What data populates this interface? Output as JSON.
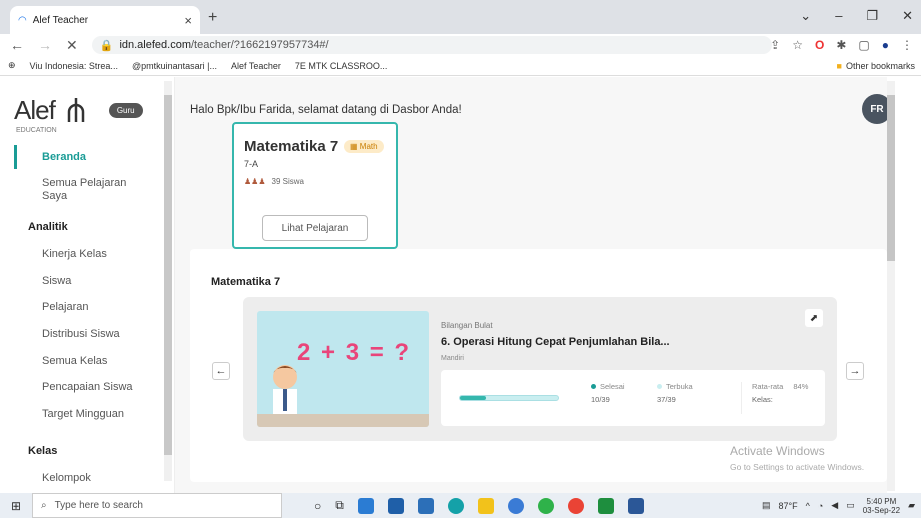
{
  "browser": {
    "tab_title": "Alef Teacher",
    "url_domain": "idn.alefed.com",
    "url_path": "/teacher/?1662197957734#/",
    "bookmarks": [
      "Viu Indonesia: Strea...",
      "@pmtkuinantasari |...",
      "Alef Teacher",
      "7E MTK CLASSROO..."
    ],
    "other_bookmarks": "Other bookmarks"
  },
  "sidebar": {
    "logo_text": "Alef",
    "logo_sub": "EDUCATION",
    "role_badge": "Guru",
    "items": [
      {
        "label": "Beranda"
      },
      {
        "label": "Semua Pelajaran Saya"
      }
    ],
    "analitik_header": "Analitik",
    "analitik_items": [
      "Kinerja Kelas",
      "Siswa",
      "Pelajaran",
      "Distribusi Siswa",
      "Semua Kelas",
      "Pencapaian Siswa",
      "Target Mingguan"
    ],
    "kelas_header": "Kelas",
    "kelas_items": [
      "Kelompok"
    ]
  },
  "main": {
    "greeting": "Halo Bpk/Ibu Farida, selamat datang di Dasbor Anda!",
    "avatar_initials": "FR",
    "course_card": {
      "title": "Matematika 7",
      "subject_badge": "Math",
      "class": "7-A",
      "students": "39 Siswa",
      "button": "Lihat Pelajaran"
    },
    "panel": {
      "title": "Matematika 7",
      "lesson": {
        "category": "Bilangan Bulat",
        "title": "6. Operasi Hitung Cepat Penjumlahan Bila...",
        "mode": "Mandiri",
        "thumbnail_equation": "2 + 3 = ?",
        "progress_fraction": 0.27,
        "completed_label": "Selesai",
        "completed_value": "10/39",
        "open_label": "Terbuka",
        "open_value": "37/39",
        "avg_label": "Rata-rata",
        "avg_value": "84%",
        "avg_sub": "Kelas:"
      }
    }
  },
  "watermark": {
    "title": "Activate Windows",
    "sub": "Go to Settings to activate Windows."
  },
  "taskbar": {
    "search_placeholder": "Type here to search",
    "weather": "87°F",
    "time": "5:40 PM",
    "date": "03-Sep-22"
  },
  "colors": {
    "accent": "#35b7ad",
    "accent_dark": "#1a9c96",
    "badge": "#fdebc8"
  }
}
